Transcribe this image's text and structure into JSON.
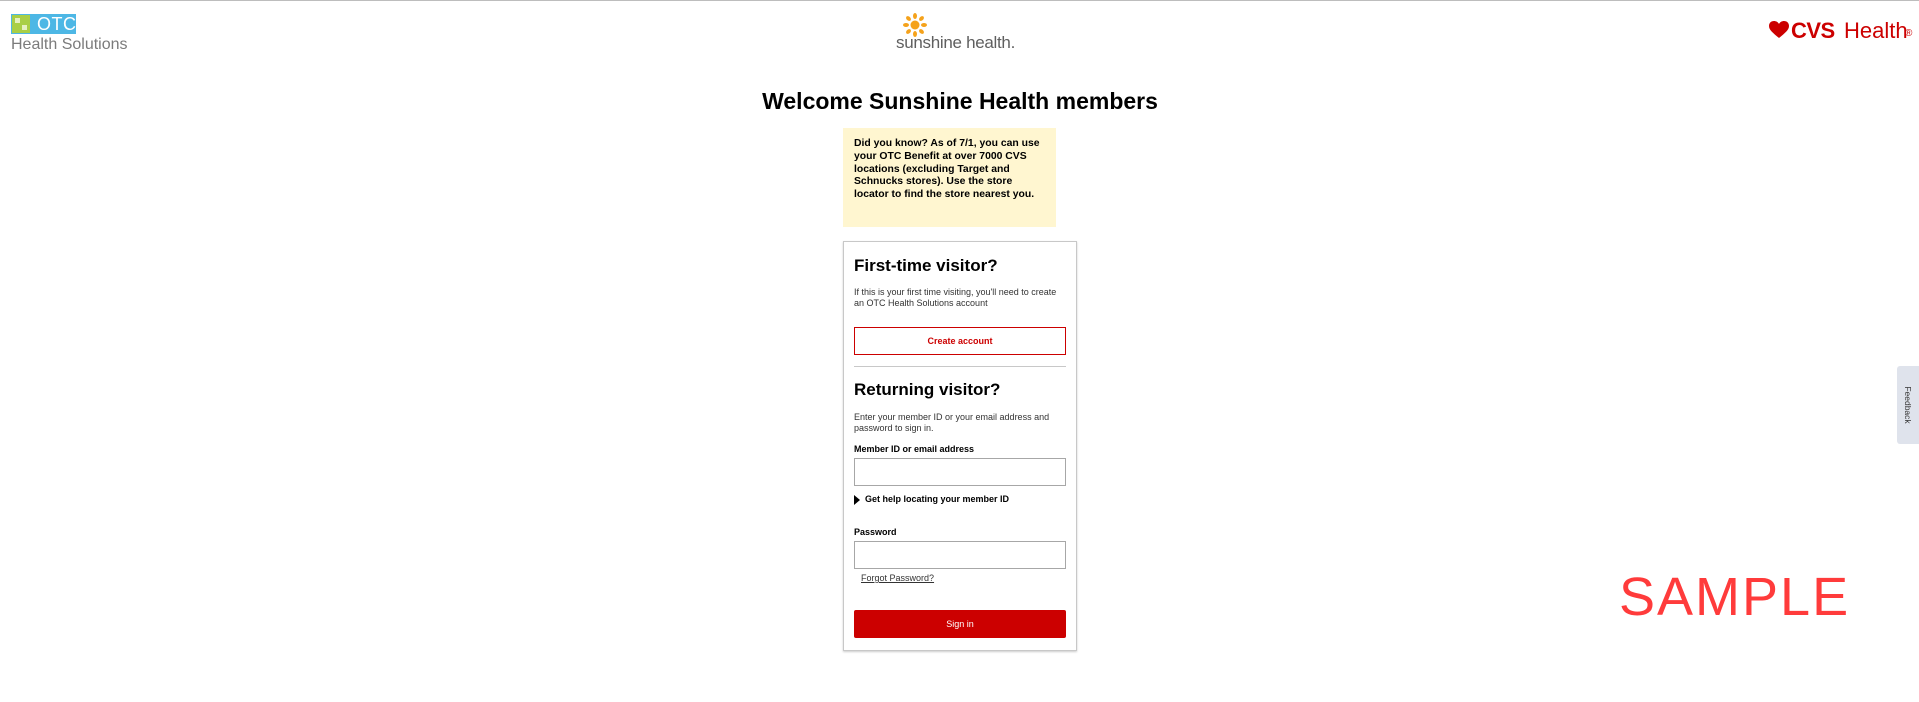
{
  "header": {
    "otc_logo_top": "OTC",
    "otc_logo_bottom": "Health Solutions",
    "sunshine_logo": "sunshine health.",
    "cvs_logo_brand": "CVS",
    "cvs_logo_health": "Health",
    "cvs_logo_mark": "®"
  },
  "page": {
    "title": "Welcome Sunshine Health members"
  },
  "notice": {
    "text": "Did you know? As of 7/1, you can use your OTC Benefit at over 7000 CVS locations (excluding Target and Schnucks stores). Use the store locator to find the store nearest you."
  },
  "first_time": {
    "heading": "First-time visitor?",
    "description": "If this is your first time visiting, you'll need to create an OTC Health Solutions account",
    "create_button": "Create account"
  },
  "returning": {
    "heading": "Returning visitor?",
    "description": "Enter your member ID or your email address and password to sign in.",
    "member_label": "Member ID or email address",
    "member_value": "",
    "help_link": "Get help locating your member ID",
    "password_label": "Password",
    "password_value": "",
    "forgot_link": "Forgot Password?",
    "sign_in_button": "Sign in"
  },
  "feedback": {
    "label": "Feedback"
  },
  "watermark": {
    "text": "SAMPLE"
  },
  "colors": {
    "brand_red": "#cc0000",
    "notice_bg": "#fff6d0",
    "otc_blue": "#4db7e5",
    "otc_green": "#a9cf46"
  }
}
